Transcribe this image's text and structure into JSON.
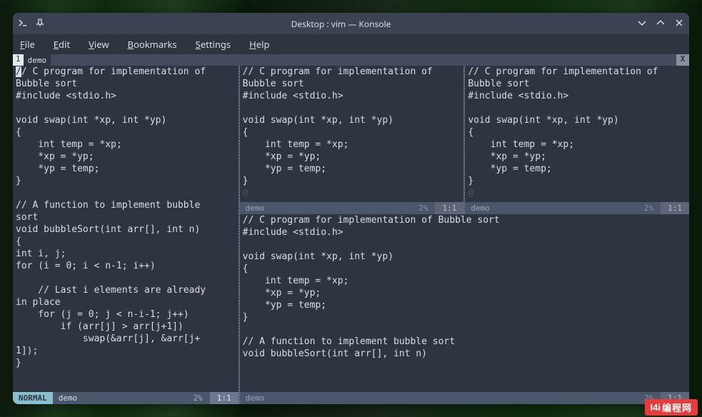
{
  "window": {
    "title": "Desktop : vim — Konsole"
  },
  "menu": [
    "File",
    "Edit",
    "View",
    "Bookmarks",
    "Settings",
    "Help"
  ],
  "tabbar": {
    "num": "1",
    "name": " demo",
    "close": "X"
  },
  "code_full": "// C program for implementation of\nBubble sort\n#include <stdio.h>\n\nvoid swap(int *xp, int *yp)\n{\n    int temp = *xp;\n    *xp = *yp;\n    *yp = temp;\n}\n\n// A function to implement bubble\nsort\nvoid bubbleSort(int arr[], int n)\n{\nint i, j;\nfor (i = 0; i < n-1; i++)\n\n    // Last i elements are already\nin place\n    for (j = 0; j < n-i-1; j++)\n        if (arr[j] > arr[j+1])\n            swap(&arr[j], &arr[j+\n1]);\n}",
  "code_top": "// C program for implementation of\nBubble sort\n#include <stdio.h>\n\nvoid swap(int *xp, int *yp)\n{\n    int temp = *xp;\n    *xp = *yp;\n    *yp = temp;\n}\n",
  "code_bottom": "// C program for implementation of Bubble sort\n#include <stdio.h>\n\nvoid swap(int *xp, int *yp)\n{\n    int temp = *xp;\n    *xp = *yp;\n    *yp = temp;\n}\n\n// A function to implement bubble sort\nvoid bubbleSort(int arr[], int n)",
  "eob": "@",
  "status": {
    "active": {
      "mode": "NORMAL",
      "file": "demo",
      "pct": "2%",
      "pos": "1:1"
    },
    "inactive": {
      "file": "demo",
      "pct": "2%",
      "pos": "1:1"
    }
  },
  "watermark": {
    "icon": "I4i",
    "text": "编程网"
  }
}
